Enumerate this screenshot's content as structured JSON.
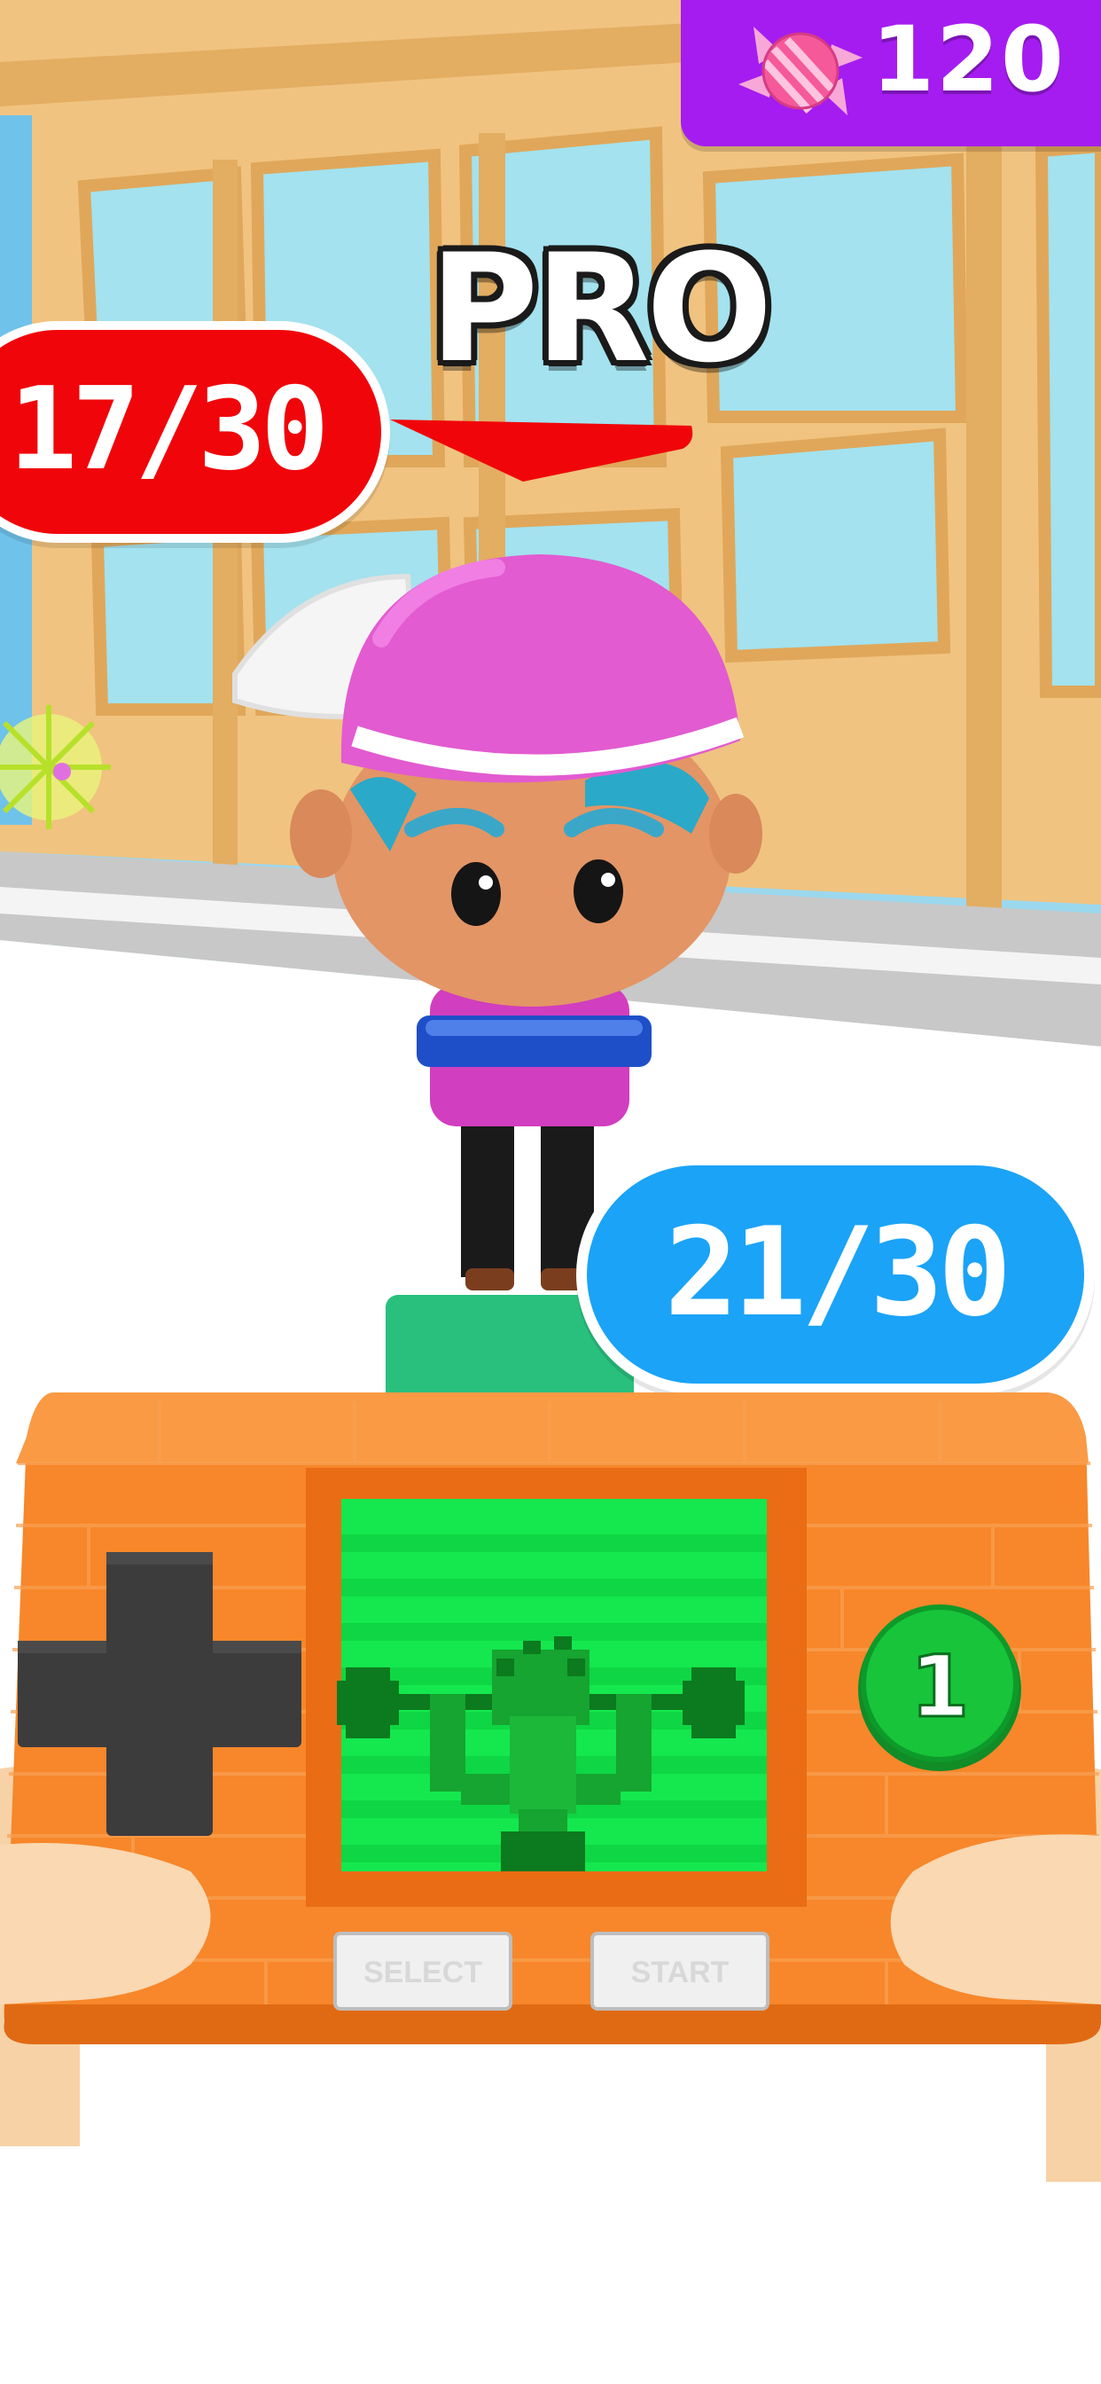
{
  "hud": {
    "candy_count": "120",
    "rank_label": "PRO",
    "opponent_score": "17/30",
    "player_score": "21/30"
  },
  "console": {
    "select_label": "SELECT",
    "start_label": "START",
    "action_button_label": "1"
  },
  "colors": {
    "candy_panel": "#a51cf0",
    "opponent": "#f0060a",
    "player": "#1ba3f7",
    "console_body": "#f7872a",
    "screen": "#14e84e",
    "action_button": "#18c43a"
  },
  "icons": [
    "candy-icon",
    "dpad-icon",
    "weightlifter-icon"
  ]
}
